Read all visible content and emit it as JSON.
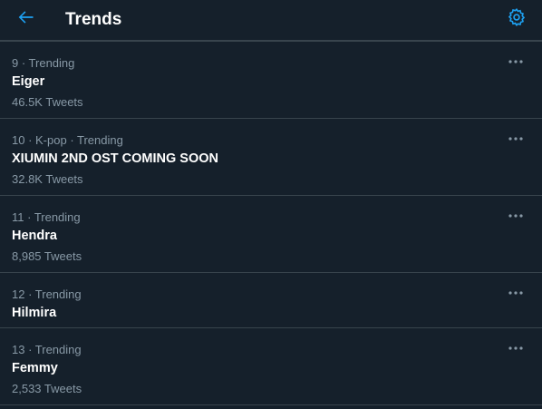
{
  "header": {
    "title": "Trends",
    "back_icon": "arrow-left-icon",
    "settings_icon": "gear-icon",
    "accent_color": "#1da1f2"
  },
  "trends": [
    {
      "rank": "9",
      "context": "Trending",
      "meta": "9 · Trending",
      "name": "Eiger",
      "tweets": "46.5K Tweets"
    },
    {
      "rank": "10",
      "context": "K-pop · Trending",
      "meta": "10 · K-pop · Trending",
      "name": "XIUMIN 2ND OST COMING SOON",
      "tweets": "32.8K Tweets"
    },
    {
      "rank": "11",
      "context": "Trending",
      "meta": "11 · Trending",
      "name": "Hendra",
      "tweets": "8,985 Tweets"
    },
    {
      "rank": "12",
      "context": "Trending",
      "meta": "12 · Trending",
      "name": "Hilmira",
      "tweets": ""
    },
    {
      "rank": "13",
      "context": "Trending",
      "meta": "13 · Trending",
      "name": "Femmy",
      "tweets": "2,533 Tweets"
    }
  ],
  "colors": {
    "background": "#15202b",
    "divider": "#38444d",
    "secondary_text": "#8899a6",
    "primary_text": "#ffffff"
  }
}
